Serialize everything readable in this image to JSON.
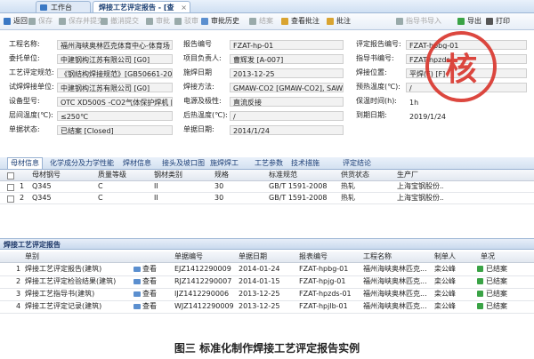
{
  "tabs": [
    {
      "label": "工作台"
    },
    {
      "label": "焊接工艺评定报告 - [查看]"
    }
  ],
  "toolbar": {
    "items": [
      {
        "label": "返回",
        "icon": "back-icon",
        "enabled": true
      },
      {
        "label": "保存",
        "icon": "save-icon",
        "enabled": false
      },
      {
        "label": "保存并提交",
        "icon": "submit-icon",
        "enabled": false
      },
      {
        "label": "撤消提交",
        "icon": "undo-icon",
        "enabled": false
      },
      {
        "label": "审批",
        "icon": "approve-icon",
        "enabled": false
      },
      {
        "label": "驳审",
        "icon": "reject-icon",
        "enabled": false
      },
      {
        "label": "审批历史",
        "icon": "history-icon",
        "enabled": true
      },
      {
        "label": "结案",
        "icon": "close-case-icon",
        "enabled": false
      },
      {
        "label": "查看批注",
        "icon": "view-note-icon",
        "enabled": true
      },
      {
        "label": "批注",
        "icon": "note-icon",
        "enabled": true
      },
      {
        "label": "指导书导入",
        "icon": "import-icon",
        "enabled": false
      },
      {
        "label": "导出",
        "icon": "export-icon",
        "enabled": true
      },
      {
        "label": "打印",
        "icon": "print-icon",
        "enabled": true
      }
    ]
  },
  "form": {
    "engineering_name": {
      "label": "工程名称:",
      "value": "福州海峡奥林匹克体育中心-体育场"
    },
    "commission_unit": {
      "label": "委托单位:",
      "value": "中建钢构江苏有限公司 [G0]"
    },
    "eval_standard": {
      "label": "工艺评定规范:",
      "value": "《钢结构焊接规范》[GB50661-20"
    },
    "test_unit": {
      "label": "试焊焊接单位:",
      "value": "中建钢构江苏有限公司 [G0]"
    },
    "equipment_model": {
      "label": "设备型号:",
      "value": "OTC XD500S -CO2气体保护焊机 [C"
    },
    "interpass_temp": {
      "label": "层间温度(℃):",
      "value": "≤250℃"
    },
    "doc_status": {
      "label": "单据状态:",
      "value": "已结案 [Closed]"
    },
    "report_no": {
      "label": "报告编号",
      "value": "FZAT-hp-01"
    },
    "project_lead": {
      "label": "项目负责人:",
      "value": "曹辉发 [A-007]"
    },
    "weld_date": {
      "label": "施焊日期",
      "value": "2013-12-25"
    },
    "weld_method": {
      "label": "焊接方法:",
      "value": "GMAW-CO2 [GMAW-CO2], SAW-S ["
    },
    "polarity": {
      "label": "电源及极性:",
      "value": "直流反接"
    },
    "post_heat_temp": {
      "label": "后热温度(℃):",
      "value": "/"
    },
    "doc_date": {
      "label": "单据日期:",
      "value": "2014/1/24"
    },
    "eval_report_no": {
      "label": "评定报告编号:",
      "value": "FZAT-hpbg-01"
    },
    "guide_no": {
      "label": "指导书编号:",
      "value": "FZAT-hpzds-"
    },
    "weld_position": {
      "label": "焊接位置:",
      "value": "平焊(F) [F]"
    },
    "preheat_temp": {
      "label": "预热温度(℃):",
      "value": "/"
    },
    "hold_time": {
      "label": "保温时间(h):",
      "value": "1h"
    },
    "due_date": {
      "label": "到期日期:",
      "value": "2019/1/24"
    }
  },
  "stamp": {
    "text": "核"
  },
  "subtabs": [
    "母材信息",
    "化学成分及力学性能",
    "焊材信息",
    "接头及坡口图",
    "施焊焊工",
    "工艺参数",
    "技术措施",
    "评定结论"
  ],
  "material_grid": {
    "headers": [
      "母材钢号",
      "质量等级",
      "钢材类别",
      "规格",
      "标准规范",
      "供货状态",
      "生产厂"
    ],
    "rows": [
      {
        "no": "1",
        "steel": "Q345",
        "grade": "C",
        "category": "II",
        "spec": "30",
        "standard": "GB/T 1591-2008",
        "supply": "热轧",
        "maker": "上海宝钢股份..."
      },
      {
        "no": "2",
        "steel": "Q345",
        "grade": "C",
        "category": "II",
        "spec": "30",
        "standard": "GB/T 1591-2008",
        "supply": "热轧",
        "maker": "上海宝钢股份..."
      }
    ]
  },
  "section2": {
    "title": "焊接工艺评定报告"
  },
  "doc_grid": {
    "headers": [
      "单别",
      "单据编号",
      "单据日期",
      "报表编号",
      "工程名称",
      "制单人",
      "单况"
    ],
    "view_label": "查看",
    "rows": [
      {
        "no": "1",
        "type": "焊接工艺评定报告(建筑)",
        "doc_no": "EJZ1412290009",
        "date": "2014-01-24",
        "report": "FZAT-hpbg-01",
        "project": "福州海峡奥林匹克...",
        "maker": "栾公峰",
        "status": "已结案"
      },
      {
        "no": "2",
        "type": "焊接工艺评定检验结果(建筑)",
        "doc_no": "RJZ1412290007",
        "date": "2014-01-15",
        "report": "FZAT-hpjg-01",
        "project": "福州海峡奥林匹克...",
        "maker": "栾公峰",
        "status": "已结案"
      },
      {
        "no": "3",
        "type": "焊接工艺指导书(建筑)",
        "doc_no": "IJZ1412290006",
        "date": "2013-12-25",
        "report": "FZAT-hpzds-01",
        "project": "福州海峡奥林匹克...",
        "maker": "栾公峰",
        "status": "已结案"
      },
      {
        "no": "4",
        "type": "焊接工艺评定记录(建筑)",
        "doc_no": "WJZ1412290009",
        "date": "2013-12-25",
        "report": "FZAT-hpjlb-01",
        "project": "福州海峡奥林匹克...",
        "maker": "栾公峰",
        "status": "已结案"
      }
    ]
  },
  "caption": "图三 标准化制作焊接工艺评定报告实例",
  "colors": {
    "accent": "#3a78c4",
    "stamp": "#d9342b",
    "ok": "#3aa346"
  }
}
